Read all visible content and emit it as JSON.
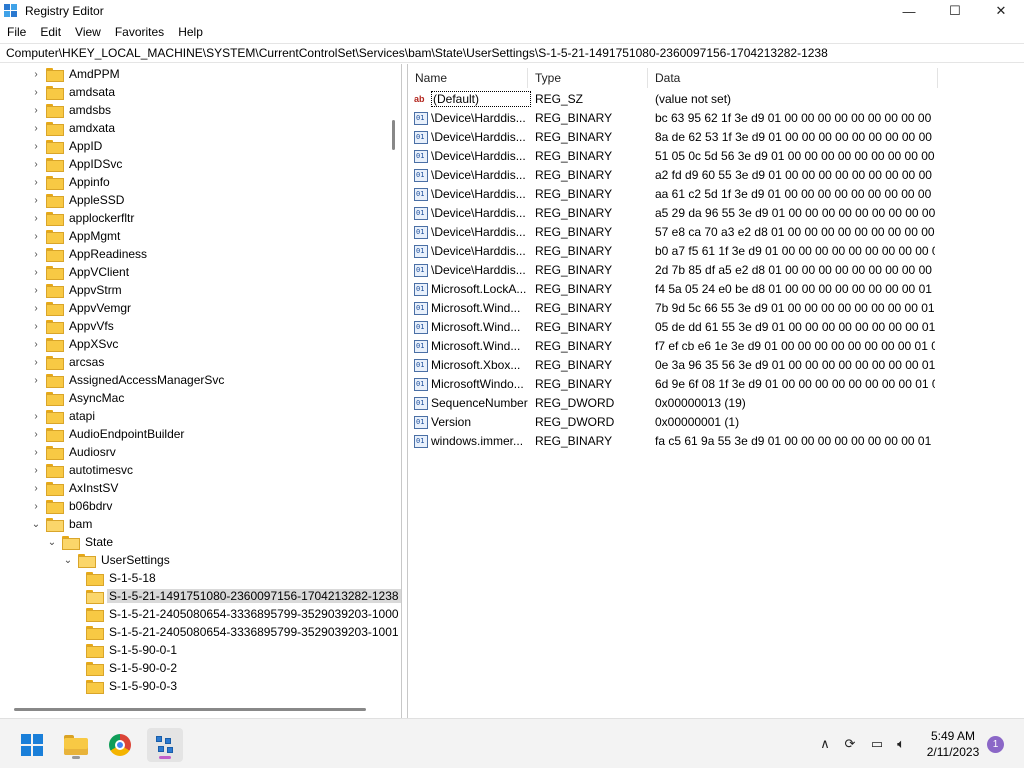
{
  "window": {
    "title": "Registry Editor",
    "controls": {
      "minimize": "—",
      "maximize": "☐",
      "close": "✕"
    }
  },
  "menu": [
    "File",
    "Edit",
    "View",
    "Favorites",
    "Help"
  ],
  "address": "Computer\\HKEY_LOCAL_MACHINE\\SYSTEM\\CurrentControlSet\\Services\\bam\\State\\UserSettings\\S-1-5-21-1491751080-2360097156-1704213282-1238",
  "tree": [
    {
      "label": "AmdPPM",
      "level": 0,
      "expander": "collapsed"
    },
    {
      "label": "amdsata",
      "level": 0,
      "expander": "collapsed"
    },
    {
      "label": "amdsbs",
      "level": 0,
      "expander": "collapsed"
    },
    {
      "label": "amdxata",
      "level": 0,
      "expander": "collapsed"
    },
    {
      "label": "AppID",
      "level": 0,
      "expander": "collapsed"
    },
    {
      "label": "AppIDSvc",
      "level": 0,
      "expander": "collapsed"
    },
    {
      "label": "Appinfo",
      "level": 0,
      "expander": "collapsed"
    },
    {
      "label": "AppleSSD",
      "level": 0,
      "expander": "collapsed"
    },
    {
      "label": "applockerfltr",
      "level": 0,
      "expander": "collapsed"
    },
    {
      "label": "AppMgmt",
      "level": 0,
      "expander": "collapsed"
    },
    {
      "label": "AppReadiness",
      "level": 0,
      "expander": "collapsed"
    },
    {
      "label": "AppVClient",
      "level": 0,
      "expander": "collapsed"
    },
    {
      "label": "AppvStrm",
      "level": 0,
      "expander": "collapsed"
    },
    {
      "label": "AppvVemgr",
      "level": 0,
      "expander": "collapsed"
    },
    {
      "label": "AppvVfs",
      "level": 0,
      "expander": "collapsed"
    },
    {
      "label": "AppXSvc",
      "level": 0,
      "expander": "collapsed"
    },
    {
      "label": "arcsas",
      "level": 0,
      "expander": "collapsed"
    },
    {
      "label": "AssignedAccessManagerSvc",
      "level": 0,
      "expander": "collapsed"
    },
    {
      "label": "AsyncMac",
      "level": 0,
      "expander": "none"
    },
    {
      "label": "atapi",
      "level": 0,
      "expander": "collapsed"
    },
    {
      "label": "AudioEndpointBuilder",
      "level": 0,
      "expander": "collapsed"
    },
    {
      "label": "Audiosrv",
      "level": 0,
      "expander": "collapsed"
    },
    {
      "label": "autotimesvc",
      "level": 0,
      "expander": "collapsed"
    },
    {
      "label": "AxInstSV",
      "level": 0,
      "expander": "collapsed"
    },
    {
      "label": "b06bdrv",
      "level": 0,
      "expander": "collapsed"
    },
    {
      "label": "bam",
      "level": 0,
      "expander": "expanded",
      "open": true
    },
    {
      "label": "State",
      "level": 1,
      "expander": "expanded",
      "open": true
    },
    {
      "label": "UserSettings",
      "level": 2,
      "expander": "expanded",
      "open": true
    },
    {
      "label": "S-1-5-18",
      "level": 3,
      "expander": "none"
    },
    {
      "label": "S-1-5-21-1491751080-2360097156-1704213282-1238",
      "level": 3,
      "expander": "none",
      "selected": true,
      "open": true
    },
    {
      "label": "S-1-5-21-2405080654-3336895799-3529039203-1000",
      "level": 3,
      "expander": "none"
    },
    {
      "label": "S-1-5-21-2405080654-3336895799-3529039203-1001",
      "level": 3,
      "expander": "none"
    },
    {
      "label": "S-1-5-90-0-1",
      "level": 3,
      "expander": "none"
    },
    {
      "label": "S-1-5-90-0-2",
      "level": 3,
      "expander": "none"
    },
    {
      "label": "S-1-5-90-0-3",
      "level": 3,
      "expander": "none"
    }
  ],
  "values_header": {
    "name": "Name",
    "type": "Type",
    "data": "Data"
  },
  "values": [
    {
      "name": "(Default)",
      "type": "REG_SZ",
      "data": "(value not set)",
      "icon": "string-value-icon"
    },
    {
      "name": "\\Device\\Harddis...",
      "type": "REG_BINARY",
      "data": "bc 63 95 62 1f 3e d9 01 00 00 00 00 00 00 00 00 00 00...",
      "icon": "binary-value-icon"
    },
    {
      "name": "\\Device\\Harddis...",
      "type": "REG_BINARY",
      "data": "8a de 62 53 1f 3e d9 01 00 00 00 00 00 00 00 00 00 00...",
      "icon": "binary-value-icon"
    },
    {
      "name": "\\Device\\Harddis...",
      "type": "REG_BINARY",
      "data": "51 05 0c 5d 56 3e d9 01 00 00 00 00 00 00 00 00 00 00 0...",
      "icon": "binary-value-icon"
    },
    {
      "name": "\\Device\\Harddis...",
      "type": "REG_BINARY",
      "data": "a2 fd d9 60 55 3e d9 01 00 00 00 00 00 00 00 00 00 00 0...",
      "icon": "binary-value-icon"
    },
    {
      "name": "\\Device\\Harddis...",
      "type": "REG_BINARY",
      "data": "aa 61 c2 5d 1f 3e d9 01 00 00 00 00 00 00 00 00 00 00...",
      "icon": "binary-value-icon"
    },
    {
      "name": "\\Device\\Harddis...",
      "type": "REG_BINARY",
      "data": "a5 29 da 96 55 3e d9 01 00 00 00 00 00 00 00 00 00 00 0...",
      "icon": "binary-value-icon"
    },
    {
      "name": "\\Device\\Harddis...",
      "type": "REG_BINARY",
      "data": "57 e8 ca 70 a3 e2 d8 01 00 00 00 00 00 00 00 00 00 00 0...",
      "icon": "binary-value-icon"
    },
    {
      "name": "\\Device\\Harddis...",
      "type": "REG_BINARY",
      "data": "b0 a7 f5 61 1f 3e d9 01 00 00 00 00 00 00 00 00 00 00...",
      "icon": "binary-value-icon"
    },
    {
      "name": "\\Device\\Harddis...",
      "type": "REG_BINARY",
      "data": "2d 7b 85 df a5 e2 d8 01 00 00 00 00 00 00 00 00 00 00 0...",
      "icon": "binary-value-icon"
    },
    {
      "name": "Microsoft.LockA...",
      "type": "REG_BINARY",
      "data": "f4 5a 05 24 e0 be d8 01 00 00 00 00 00 00 00 00 01 00...",
      "icon": "binary-value-icon"
    },
    {
      "name": "Microsoft.Wind...",
      "type": "REG_BINARY",
      "data": "7b 9d 5c 66 55 3e d9 01 00 00 00 00 00 00 00 00 01 0...",
      "icon": "binary-value-icon"
    },
    {
      "name": "Microsoft.Wind...",
      "type": "REG_BINARY",
      "data": "05 de dd 61 55 3e d9 01 00 00 00 00 00 00 00 00 01 0...",
      "icon": "binary-value-icon"
    },
    {
      "name": "Microsoft.Wind...",
      "type": "REG_BINARY",
      "data": "f7 ef cb e6 1e 3e d9 01 00 00 00 00 00 00 00 00 01 00...",
      "icon": "binary-value-icon"
    },
    {
      "name": "Microsoft.Xbox...",
      "type": "REG_BINARY",
      "data": "0e 3a 96 35 56 3e d9 01 00 00 00 00 00 00 00 00 01 0...",
      "icon": "binary-value-icon"
    },
    {
      "name": "MicrosoftWindo...",
      "type": "REG_BINARY",
      "data": "6d 9e 6f 08 1f 3e d9 01 00 00 00 00 00 00 00 00 01 00...",
      "icon": "binary-value-icon"
    },
    {
      "name": "SequenceNumber",
      "type": "REG_DWORD",
      "data": "0x00000013 (19)",
      "icon": "binary-value-icon"
    },
    {
      "name": "Version",
      "type": "REG_DWORD",
      "data": "0x00000001 (1)",
      "icon": "binary-value-icon"
    },
    {
      "name": "windows.immer...",
      "type": "REG_BINARY",
      "data": "fa c5 61 9a 55 3e d9 01 00 00 00 00 00 00 00 00 01 00...",
      "icon": "binary-value-icon"
    }
  ],
  "taskbar": {
    "apps": [
      "start-icon",
      "file-explorer-icon",
      "chrome-icon",
      "registry-editor-icon"
    ],
    "tray": [
      "chevron-up-icon",
      "sync-icon",
      "network-icon",
      "volume-icon"
    ],
    "time": "5:49 AM",
    "date": "2/11/2023",
    "notification_count": "1"
  }
}
